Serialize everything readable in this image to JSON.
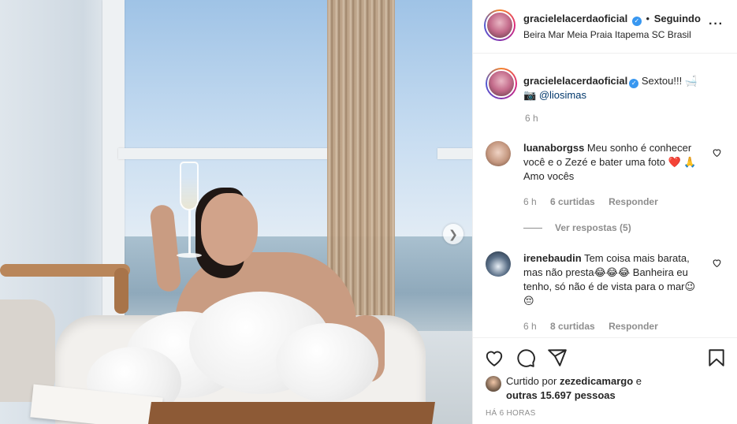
{
  "header": {
    "username": "gracielelacerdaoficial",
    "separator": "•",
    "follow_status": "Seguindo",
    "location": "Beira Mar Meia Praia Itapema SC Brasil"
  },
  "caption": {
    "username": "gracielelacerdaoficial",
    "text": "Sextou!!! 🛁",
    "credit_icon": "📷",
    "mention": "@liosimas",
    "time": "6 h"
  },
  "comments": [
    {
      "username": "luanaborgss",
      "text": "Meu sonho é conhecer você e o Zezé e bater uma foto ❤️ 🙏 Amo vocês",
      "time": "6 h",
      "likes": "6 curtidas",
      "reply": "Responder"
    },
    {
      "username": "irenebaudin",
      "text": "Tem coisa mais barata, mas não presta😂😂😂 Banheira eu tenho, só não é de vista para o mar😉😔",
      "time": "6 h",
      "likes": "8 curtidas",
      "reply": "Responder"
    }
  ],
  "view_replies": "Ver respostas (5)",
  "likes": {
    "prefix": "Curtido por",
    "user": "zezedicamargo",
    "connector": "e",
    "others": "outras 15.697 pessoas"
  },
  "posted_ago": "HÁ 6 HORAS",
  "icons": {
    "more": "more-options-icon",
    "verified": "verified-badge-icon",
    "like": "heart-icon",
    "comment": "comment-icon",
    "share": "share-icon",
    "save": "bookmark-icon",
    "next": "chevron-right-icon"
  },
  "colors": {
    "verified_blue": "#3897f0",
    "text": "#262626",
    "muted": "#8e8e8e",
    "mention": "#00376b",
    "border": "#efefef"
  }
}
